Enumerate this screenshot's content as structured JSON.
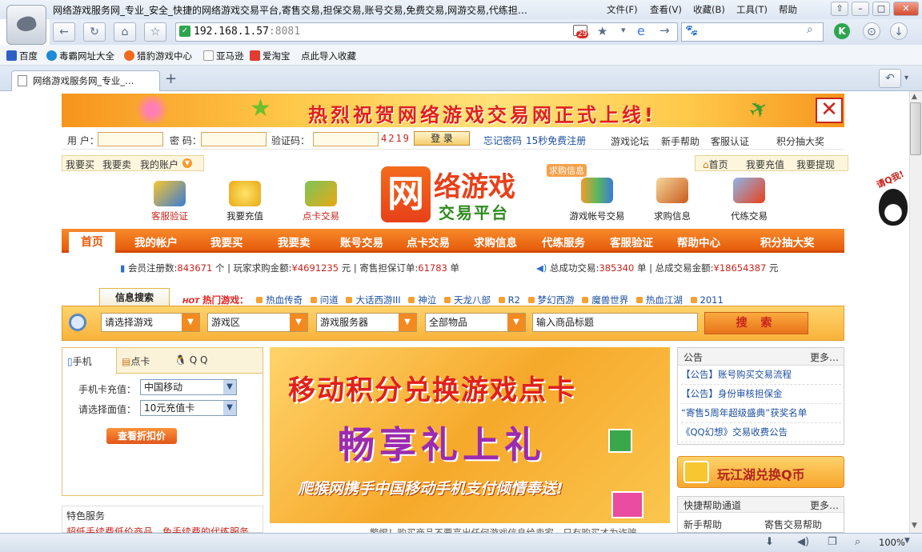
{
  "browser": {
    "window_title": "网络游戏服务网_专业_安全_快捷的网络游戏交易平台,寄售交易,担保交易,账号交易,免费交易,网游交易,代练担…",
    "menu": [
      "文件(F)",
      "查看(V)",
      "收藏(B)",
      "工具(T)",
      "帮助"
    ],
    "address_host": "192.168.1.57",
    "address_port": ":8081",
    "badge_count": "29",
    "favorites": [
      "百度",
      "毒霸网址大全",
      "猎豹游戏中心",
      "亚马逊",
      "爱淘宝",
      "点此导入收藏"
    ],
    "tab_title": "网络游戏服务网_专业_…",
    "new_tab": "+",
    "zoom": "100%"
  },
  "banner": {
    "text": "热烈祝贺网络游戏交易网正式上线!",
    "close": "✕"
  },
  "login": {
    "user_label": "用 户：",
    "pass_label": "密 码：",
    "captcha_label": "验证码：",
    "captcha_value": "4219",
    "login_button": "登 录",
    "forgot": "忘记密码",
    "register": "15秒免费注册",
    "links": [
      "游戏论坛",
      "新手帮助",
      "客服认证",
      "积分抽大奖"
    ]
  },
  "quicknav": {
    "left": [
      "我要买",
      "我要卖",
      "我的账户"
    ],
    "right": [
      "首页",
      "我要充值",
      "我要提现"
    ]
  },
  "icons": [
    {
      "label": "客服验证",
      "name": "customer-verify-icon",
      "red": true
    },
    {
      "label": "我要充值",
      "name": "recharge-icon",
      "red": false
    },
    {
      "label": "点卡交易",
      "name": "point-card-icon",
      "red": true
    },
    {
      "label": "游戏帐号交易",
      "name": "account-trade-icon",
      "red": false
    },
    {
      "label": "求购信息",
      "name": "purchase-info-icon",
      "red": false
    },
    {
      "label": "代练交易",
      "name": "leveling-icon",
      "red": false
    }
  ],
  "logo": {
    "big": "网",
    "title": "络游戏",
    "subtitle": "交易平台",
    "tag": "求购信息"
  },
  "mainnav": [
    "首页",
    "我的帐户",
    "我要买",
    "我要卖",
    "账号交易",
    "点卡交易",
    "求购信息",
    "代练服务",
    "客服验证",
    "帮助中心",
    "积分抽大奖"
  ],
  "stats": {
    "members_label": "会员注册数:",
    "members": "843671",
    "members_unit": "个",
    "buy_label": "玩家求购金额:",
    "buy": "¥4691235",
    "buy_unit": "元",
    "consign_label": "寄售担保订单:",
    "consign": "61783",
    "consign_unit": "单",
    "total_trade_label": "总成功交易:",
    "total_trade": "385340",
    "total_trade_unit": "单",
    "total_amount_label": "总成交易金额:",
    "total_amount": "¥18654387",
    "total_amount_unit": "元"
  },
  "search": {
    "tab": "信息搜索",
    "hot_badge": "HOT",
    "hot_label": "热门游戏：",
    "hot_games": [
      "热血传奇",
      "问道",
      "大话西游III",
      "神泣",
      "天龙八部",
      "R2",
      "梦幻西游",
      "魔兽世界",
      "热血江湖",
      "2011"
    ],
    "game": "请选择游戏",
    "zone": "游戏区",
    "server": "游戏服务器",
    "items": "全部物品",
    "title_placeholder": "输入商品标题",
    "button": "搜 索"
  },
  "recharge": {
    "tabs": [
      "手机",
      "点卡",
      "Q Q"
    ],
    "card_label": "手机卡充值：",
    "card_value": "中国移动",
    "amount_label": "请选择面值：",
    "amount_value": "10元充值卡",
    "button": "查看折扣价"
  },
  "special": {
    "title": "特色服务",
    "line": "超低手续费低价商品，免手续费的代练服务"
  },
  "promo": {
    "line1": "移动积分兑换游戏点卡",
    "line2": "畅享礼上礼",
    "line3": "爬猴网携手中国移动手机支付倾情奉送!"
  },
  "notice": {
    "title": "公告",
    "more": "更多…",
    "items": [
      "【公告】账号购买交易流程",
      "【公告】身份审核担保金",
      "“寄售5周年超级盛典”获奖名单",
      "《QQ幻想》交易收费公告"
    ]
  },
  "qcoin": {
    "text": "玩江湖兑换Q币"
  },
  "help": {
    "title": "快捷帮助通道",
    "more": "更多…",
    "items": [
      "新手帮助",
      "寄售交易帮助"
    ]
  },
  "tip": "警惕！购买商品不要亮出任何游戏信息给卖家，只有购买才为诈骗...",
  "qq_float": "请Q我!"
}
